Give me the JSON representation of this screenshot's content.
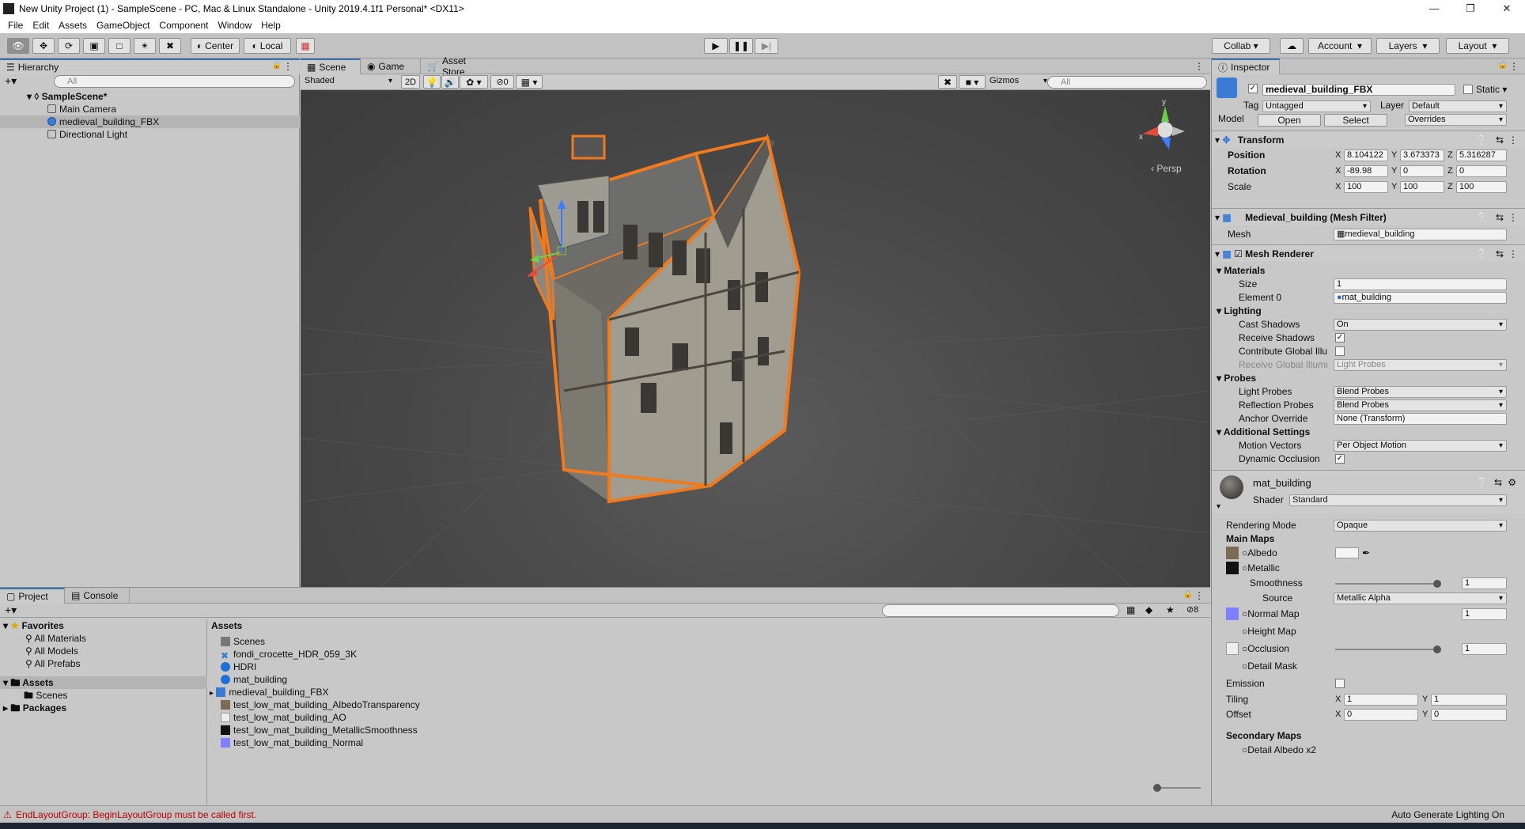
{
  "window": {
    "title": "New Unity Project (1) - SampleScene - PC, Mac & Linux Standalone - Unity 2019.4.1f1 Personal* <DX11>"
  },
  "menu": [
    "File",
    "Edit",
    "Assets",
    "GameObject",
    "Component",
    "Window",
    "Help"
  ],
  "toolbar": {
    "center": "Center",
    "local": "Local",
    "collab": "Collab",
    "account": "Account",
    "layers": "Layers",
    "layout": "Layout"
  },
  "hierarchy": {
    "tab": "Hierarchy",
    "search": "All",
    "scene": "SampleScene*",
    "items": [
      "Main Camera",
      "medieval_building_FBX",
      "Directional Light"
    ]
  },
  "scene": {
    "tabs": [
      "Scene",
      "Game",
      "Asset Store"
    ],
    "shading": "Shaded",
    "mode2d": "2D",
    "hidden_count": "0",
    "gizmos": "Gizmos",
    "search": "All",
    "persp": "Persp"
  },
  "project": {
    "tabs": [
      "Project",
      "Console"
    ],
    "hidden_count": "8",
    "favorites": "Favorites",
    "fav_items": [
      "All Materials",
      "All Models",
      "All Prefabs"
    ],
    "assets_label": "Assets",
    "tree_assets": "Assets",
    "tree_scenes": "Scenes",
    "tree_packages": "Packages",
    "items": [
      "Scenes",
      "fondi_crocette_HDR_059_3K",
      "HDRI",
      "mat_building",
      "medieval_building_FBX",
      "test_low_mat_building_AlbedoTransparency",
      "test_low_mat_building_AO",
      "test_low_mat_building_MetallicSmoothness",
      "test_low_mat_building_Normal"
    ]
  },
  "inspector": {
    "tab": "Inspector",
    "object_name": "medieval_building_FBX",
    "static": "Static",
    "tag_label": "Tag",
    "tag": "Untagged",
    "layer_label": "Layer",
    "layer": "Default",
    "model_label": "Model",
    "open": "Open",
    "select": "Select",
    "overrides": "Overrides",
    "transform": "Transform",
    "position": "Position",
    "rotation": "Rotation",
    "scale": "Scale",
    "pos": [
      "8.104122",
      "3.673373",
      "5.316287"
    ],
    "rot": [
      "-89.98",
      "0",
      "0"
    ],
    "scl": [
      "100",
      "100",
      "100"
    ],
    "meshfilter": "Medieval_building (Mesh Filter)",
    "mesh_label": "Mesh",
    "mesh": "medieval_building",
    "meshrenderer": "Mesh Renderer",
    "materials": "Materials",
    "size_label": "Size",
    "size": "1",
    "element0_label": "Element 0",
    "element0": "mat_building",
    "lighting": "Lighting",
    "cast_label": "Cast Shadows",
    "cast": "On",
    "receive_label": "Receive Shadows",
    "contribute_label": "Contribute Global Illu",
    "receive_gi_label": "Receive Global Illumi",
    "receive_gi": "Light Probes",
    "probes": "Probes",
    "lightprobes_label": "Light Probes",
    "lightprobes": "Blend Probes",
    "reflprobes_label": "Reflection Probes",
    "reflprobes": "Blend Probes",
    "anchor_label": "Anchor Override",
    "anchor": "None (Transform)",
    "additional": "Additional Settings",
    "motion_label": "Motion Vectors",
    "motion": "Per Object Motion",
    "occl_label": "Dynamic Occlusion",
    "material": "mat_building",
    "shader_label": "Shader",
    "shader": "Standard",
    "rendermode_label": "Rendering Mode",
    "rendermode": "Opaque",
    "mainmaps": "Main Maps",
    "albedo": "Albedo",
    "metallic": "Metallic",
    "smoothness_label": "Smoothness",
    "smoothness": "1",
    "source_label": "Source",
    "source": "Metallic Alpha",
    "normal": "Normal Map",
    "normal_val": "1",
    "height": "Height Map",
    "occlusion": "Occlusion",
    "occlusion_val": "1",
    "detailmask": "Detail Mask",
    "emission": "Emission",
    "tiling_label": "Tiling",
    "tiling": [
      "1",
      "1"
    ],
    "offset_label": "Offset",
    "offset": [
      "0",
      "0"
    ],
    "secondary": "Secondary Maps",
    "detail_albedo": "Detail Albedo x2"
  },
  "status": {
    "error": "EndLayoutGroup: BeginLayoutGroup must be called first.",
    "lighting": "Auto Generate Lighting On"
  },
  "colors": {
    "selection_outline": "#f07a1c",
    "accent": "#3a72b0"
  }
}
